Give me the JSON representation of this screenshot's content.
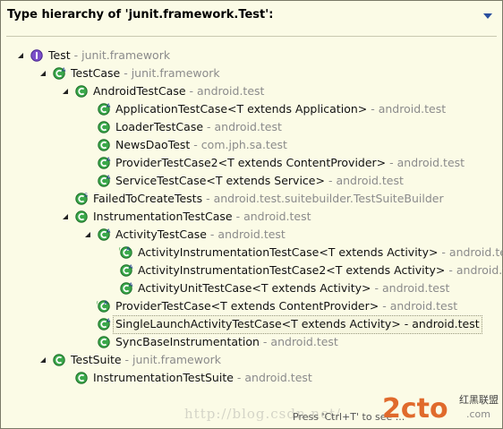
{
  "header": {
    "title": "Type hierarchy of 'junit.framework.Test':"
  },
  "tree": [
    {
      "depth": 0,
      "expanded": true,
      "icon": "interface-icon",
      "name": "Test",
      "pkg": "junit.framework",
      "mark": ""
    },
    {
      "depth": 1,
      "expanded": true,
      "icon": "class-icon",
      "name": "TestCase",
      "pkg": "junit.framework",
      "mark": "A"
    },
    {
      "depth": 2,
      "expanded": true,
      "icon": "class-icon",
      "name": "AndroidTestCase",
      "pkg": "android.test",
      "mark": ""
    },
    {
      "depth": 3,
      "expanded": null,
      "icon": "class-icon",
      "name": "ApplicationTestCase<T extends Application>",
      "pkg": "android.test",
      "mark": "A"
    },
    {
      "depth": 3,
      "expanded": null,
      "icon": "class-icon",
      "name": "LoaderTestCase",
      "pkg": "android.test",
      "mark": ""
    },
    {
      "depth": 3,
      "expanded": null,
      "icon": "class-icon",
      "name": "NewsDaoTest",
      "pkg": "com.jph.sa.test",
      "mark": ""
    },
    {
      "depth": 3,
      "expanded": null,
      "icon": "class-icon",
      "name": "ProviderTestCase2<T extends ContentProvider>",
      "pkg": "android.test",
      "mark": "A"
    },
    {
      "depth": 3,
      "expanded": null,
      "icon": "class-icon",
      "name": "ServiceTestCase<T extends Service>",
      "pkg": "android.test",
      "mark": "A"
    },
    {
      "depth": 2,
      "expanded": null,
      "icon": "class-icon",
      "name": "FailedToCreateTests",
      "pkg": "android.test.suitebuilder.TestSuiteBuilder",
      "mark": "S"
    },
    {
      "depth": 2,
      "expanded": true,
      "icon": "class-icon",
      "name": "InstrumentationTestCase",
      "pkg": "android.test",
      "mark": ""
    },
    {
      "depth": 3,
      "expanded": true,
      "icon": "class-icon",
      "name": "ActivityTestCase",
      "pkg": "android.test",
      "mark": "A"
    },
    {
      "depth": 4,
      "expanded": null,
      "icon": "class-icon",
      "name": "ActivityInstrumentationTestCase<T extends Activity>",
      "pkg": "android.test",
      "mark": "DA"
    },
    {
      "depth": 4,
      "expanded": null,
      "icon": "class-icon",
      "name": "ActivityInstrumentationTestCase2<T extends Activity>",
      "pkg": "android.test",
      "mark": "A"
    },
    {
      "depth": 4,
      "expanded": null,
      "icon": "class-icon",
      "name": "ActivityUnitTestCase<T extends Activity>",
      "pkg": "android.test",
      "mark": "A"
    },
    {
      "depth": 3,
      "expanded": null,
      "icon": "class-icon",
      "name": "ProviderTestCase<T extends ContentProvider>",
      "pkg": "android.test",
      "mark": "DA"
    },
    {
      "depth": 3,
      "expanded": null,
      "icon": "class-icon",
      "name": "SingleLaunchActivityTestCase<T extends Activity>",
      "pkg": "android.test",
      "mark": "A",
      "selected": true
    },
    {
      "depth": 3,
      "expanded": null,
      "icon": "class-icon",
      "name": "SyncBaseInstrumentation",
      "pkg": "android.test",
      "mark": ""
    },
    {
      "depth": 1,
      "expanded": true,
      "icon": "class-icon",
      "name": "TestSuite",
      "pkg": "junit.framework",
      "mark": ""
    },
    {
      "depth": 2,
      "expanded": null,
      "icon": "class-icon",
      "name": "InstrumentationTestSuite",
      "pkg": "android.test",
      "mark": ""
    }
  ],
  "separator": " - ",
  "footer": {
    "hint": "Press 'Ctrl+T' to see ..."
  },
  "watermark": "http://blog.csdn.net/",
  "logo": {
    "text": "2cto",
    "sub": "红黑联盟",
    "url": ".com"
  },
  "colors": {
    "background": "#fbfbe6",
    "class_icon": "#2f9d3f",
    "interface_icon": "#6b3fb8",
    "package_text": "#8b8b8b"
  }
}
